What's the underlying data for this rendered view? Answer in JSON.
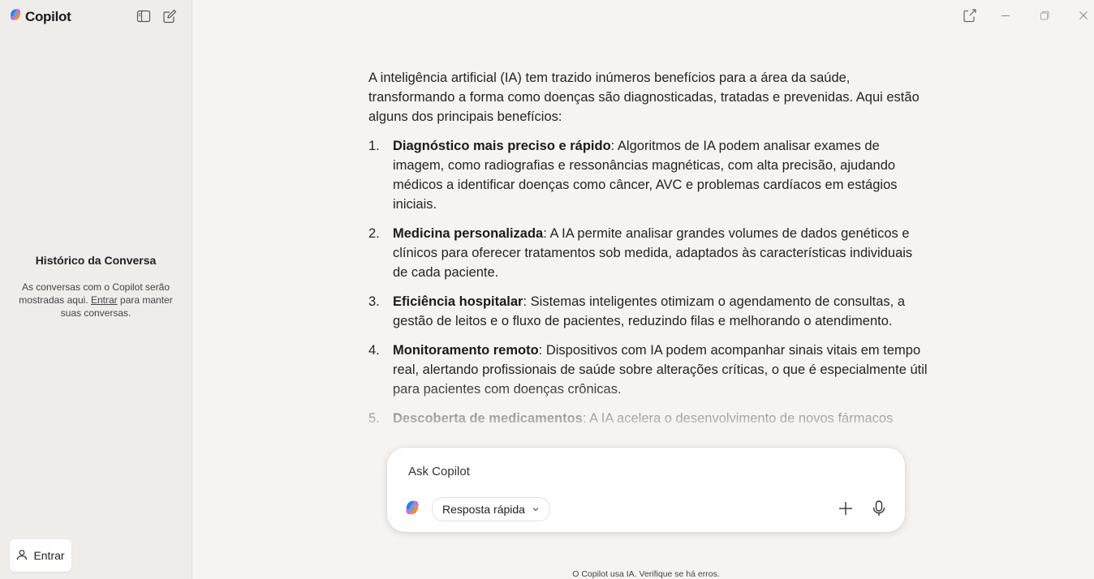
{
  "app": {
    "name": "Copilot"
  },
  "sidebar": {
    "history_title": "Histórico da Conversa",
    "history_text_before": "As conversas com o Copilot serão mostradas aqui.",
    "history_link": "Entrar",
    "history_text_after": "para manter suas conversas.",
    "signin_label": "Entrar"
  },
  "content": {
    "intro": "A inteligência artificial (IA) tem trazido inúmeros benefícios para a área da saúde, transformando a forma como doenças são diagnosticadas, tratadas e prevenidas. Aqui estão alguns dos principais benefícios:",
    "items": [
      {
        "num": "1.",
        "title": "Diagnóstico mais preciso e rápido",
        "text": ": Algoritmos de IA podem analisar exames de imagem, como radiografias e ressonâncias magnéticas, com alta precisão, ajudando médicos a identificar doenças como câncer, AVC e problemas cardíacos em estágios iniciais."
      },
      {
        "num": "2.",
        "title": "Medicina personalizada",
        "text": ": A IA permite analisar grandes volumes de dados genéticos e clínicos para oferecer tratamentos sob medida, adaptados às características individuais de cada paciente."
      },
      {
        "num": "3.",
        "title": "Eficiência hospitalar",
        "text": ": Sistemas inteligentes otimizam o agendamento de consultas, a gestão de leitos e o fluxo de pacientes, reduzindo filas e melhorando o atendimento."
      },
      {
        "num": "4.",
        "title": "Monitoramento remoto",
        "text": ": Dispositivos com IA podem acompanhar sinais vitais em tempo real, alertando profissionais de saúde sobre alterações críticas, o que é especialmente útil para pacientes com doenças crônicas."
      },
      {
        "num": "5.",
        "title": "Descoberta de medicamentos",
        "text": ": A IA acelera o desenvolvimento de novos fármacos"
      }
    ]
  },
  "composer": {
    "placeholder": "Ask Copilot",
    "mode_label": "Resposta rápida"
  },
  "footer": {
    "disclaimer": "O Copilot usa IA. Verifique se há erros."
  }
}
